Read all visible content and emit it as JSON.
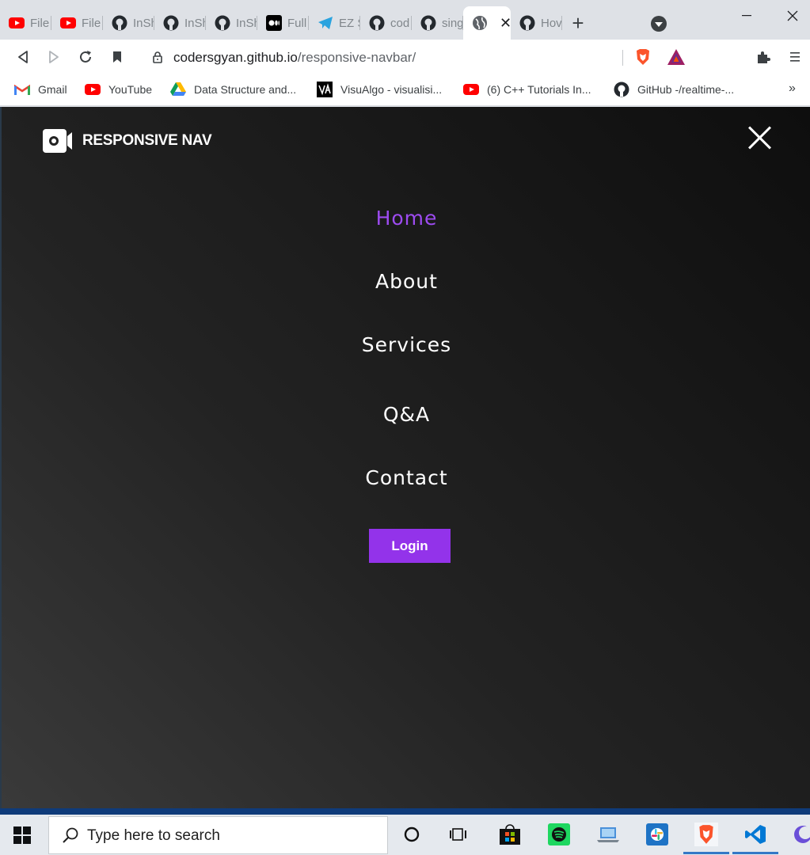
{
  "browser": {
    "tabs": [
      {
        "label": "File",
        "icon": "youtube-icon"
      },
      {
        "label": "File",
        "icon": "youtube-icon"
      },
      {
        "label": "InSh",
        "icon": "github-icon"
      },
      {
        "label": "InSh",
        "icon": "github-icon"
      },
      {
        "label": "InSh",
        "icon": "github-icon"
      },
      {
        "label": "Full",
        "icon": "medium-icon"
      },
      {
        "label": "EZ S",
        "icon": "telegram-icon"
      },
      {
        "label": "cod",
        "icon": "github-icon"
      },
      {
        "label": "sing",
        "icon": "github-icon"
      },
      {
        "label": "",
        "icon": "globe-icon",
        "active": true,
        "close": "✕"
      },
      {
        "label": "Hov",
        "icon": "github-icon"
      }
    ],
    "new_tab": "+",
    "window_controls": {
      "minimize": "—",
      "maximize": "☐",
      "close": "✕"
    },
    "address": {
      "host": "codersgyan.github.io",
      "path": "/responsive-navbar/"
    },
    "bookmarks": [
      {
        "label": "Gmail",
        "icon": "gmail-icon"
      },
      {
        "label": "YouTube",
        "icon": "youtube-icon"
      },
      {
        "label": "Data Structure and...",
        "icon": "google-drive-icon"
      },
      {
        "label": "VisuAlgo - visualisi...",
        "icon": "visualgo-icon"
      },
      {
        "label": "(6) C++ Tutorials In...",
        "icon": "youtube-icon"
      },
      {
        "label": "GitHub -/realtime-...",
        "icon": "github-icon"
      }
    ],
    "bookmarks_overflow": "»"
  },
  "page": {
    "brand": "RESPONSIVE NAV",
    "menu": [
      {
        "label": "Home",
        "active": true
      },
      {
        "label": "About"
      },
      {
        "label": "Services"
      },
      {
        "label": "Q&A"
      },
      {
        "label": "Contact"
      }
    ],
    "login_label": "Login",
    "accent_color": "#9333ea"
  },
  "taskbar": {
    "search_placeholder": "Type here to search"
  }
}
